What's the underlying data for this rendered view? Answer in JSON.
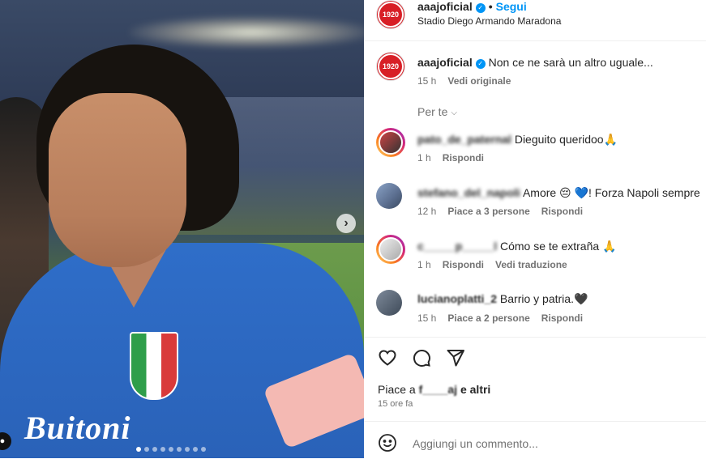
{
  "post": {
    "username": "aaajoficial",
    "follow_label": "Segui",
    "dot": "•",
    "location": "Stadio Diego Armando Maradona",
    "avatar_text": "1920",
    "caption_text": "Non ce ne sarà un altro uguale...",
    "caption_time": "15 h",
    "caption_action": "Vedi originale",
    "sort_label": "Per te",
    "image_sponsor": "Buitoni",
    "carousel_dots": 9,
    "carousel_active": 0
  },
  "comments": [
    {
      "user": "pato_de_paternal",
      "text": "Dieguito queridoo🙏",
      "time": "1 h",
      "actions": [
        "Rispondi"
      ]
    },
    {
      "user": "stefano_del_napoli",
      "text": "Amore 😔 💙! Forza Napoli sempre",
      "time": "12 h",
      "likes": "Piace a 3 persone",
      "actions": [
        "Rispondi"
      ]
    },
    {
      "user": "c_____p_____l",
      "text": "Cómo se te extraña 🙏",
      "time": "1 h",
      "actions": [
        "Rispondi",
        "Vedi traduzione"
      ]
    },
    {
      "user": "lucianoplatti_2",
      "text": "Barrio y patria.🖤",
      "time": "15 h",
      "likes": "Piace a 2 persone",
      "actions": [
        "Rispondi"
      ]
    }
  ],
  "footer": {
    "likes_prefix": "Piace a",
    "likes_user": "f____aj",
    "likes_suffix": "e altri",
    "time": "15 ore fa",
    "comment_placeholder": "Aggiungi un commento..."
  },
  "icons": [
    "heart-icon",
    "comment-icon",
    "share-icon",
    "emoji-icon",
    "verified-icon",
    "chevron-right-icon",
    "chevron-down-icon"
  ],
  "colors": {
    "accent": "#0095f6",
    "muted": "#737373",
    "text": "#262626",
    "brand_red": "#d81f26"
  }
}
